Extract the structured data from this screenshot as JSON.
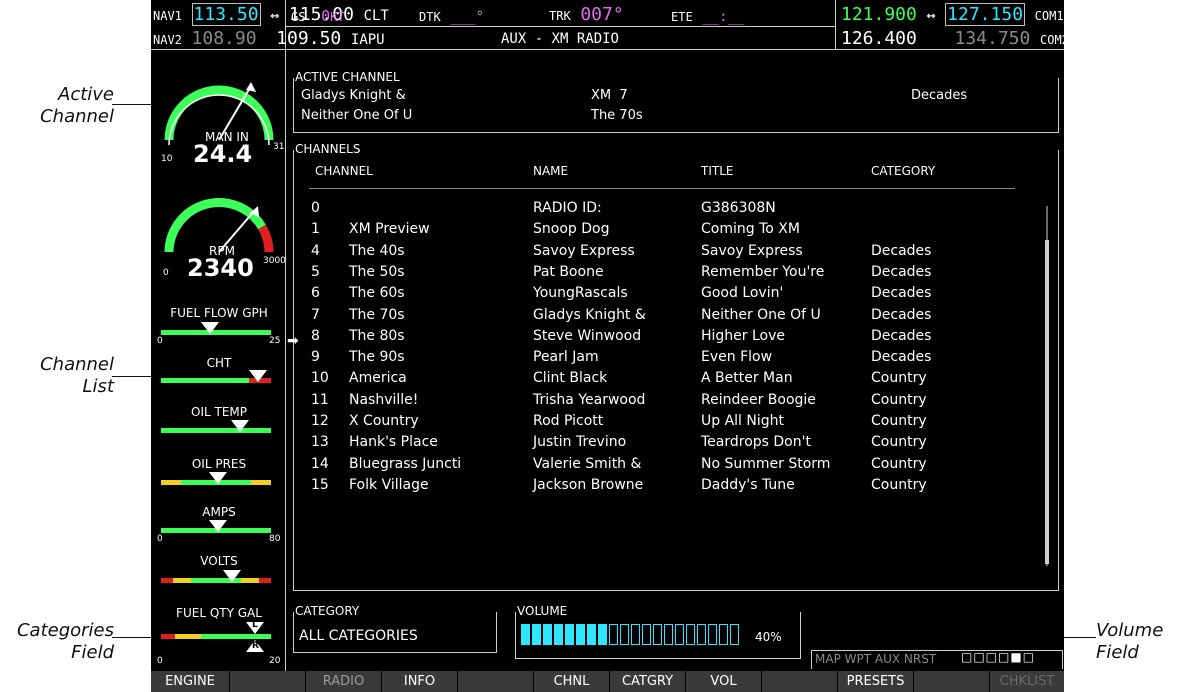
{
  "header": {
    "nav1_label": "NAV1",
    "nav1_active": "113.50",
    "nav1_arrow": "↔",
    "nav1_standby": "115.00",
    "nav1_id": "CLT",
    "nav2_label": "NAV2",
    "nav2_active": "108.90",
    "nav2_standby": "109.50",
    "nav2_id": "IAPU",
    "gs_label": "GS",
    "gs_value": "0",
    "gs_unit": "KT",
    "dtk_label": "DTK",
    "dtk_value": "___°",
    "trk_label": "TRK",
    "trk_value": "007°",
    "ete_label": "ETE",
    "ete_value": "__:__",
    "page_title": "AUX - XM RADIO",
    "com1_active": "121.900",
    "com_arrow": "↔",
    "com1_standby": "127.150",
    "com1_label": "COM1",
    "com2_active": "126.400",
    "com2_standby": "134.750",
    "com2_label": "COM2"
  },
  "engine": {
    "man_in_label": "MAN IN",
    "man_in_value": "24.4",
    "man_in_min": "10",
    "man_in_max": "31",
    "rpm_label": "RPM",
    "rpm_value": "2340",
    "rpm_min": "0",
    "rpm_max": "3000",
    "fuel_flow_label": "FUEL FLOW GPH",
    "fuel_flow_min": "0",
    "fuel_flow_max": "25",
    "cht_label": "CHT",
    "oil_temp_label": "OIL TEMP",
    "oil_pres_label": "OIL PRES",
    "amps_label": "AMPS",
    "amps_min": "0",
    "amps_max": "80",
    "volts_label": "VOLTS",
    "fuel_qty_label": "FUEL QTY GAL",
    "fuel_qty_min": "0",
    "fuel_qty_max": "20",
    "fuel_qty_left": "L",
    "fuel_qty_right": "R"
  },
  "active_channel": {
    "title": "ACTIVE CHANNEL",
    "artist": "Gladys Knight &",
    "song": "Neither One Of U",
    "channel": "XM  7",
    "channel_name": "The 70s",
    "category": "Decades"
  },
  "channels": {
    "title": "CHANNELS",
    "col_channel": "CHANNEL",
    "col_name": "NAME",
    "col_title": "TITLE",
    "col_category": "CATEGORY",
    "rows": [
      {
        "num": "0",
        "channel": "",
        "name": "RADIO ID:",
        "title": "G386308N",
        "category": ""
      },
      {
        "num": "1",
        "channel": "XM Preview",
        "name": "Snoop Dog",
        "title": "Coming To XM",
        "category": ""
      },
      {
        "num": "4",
        "channel": "The 40s",
        "name": "Savoy Express",
        "title": "Savoy Express",
        "category": "Decades"
      },
      {
        "num": "5",
        "channel": "The 50s",
        "name": "Pat Boone",
        "title": "Remember You're",
        "category": "Decades"
      },
      {
        "num": "6",
        "channel": "The 60s",
        "name": "YoungRascals",
        "title": "Good Lovin'",
        "category": "Decades"
      },
      {
        "num": "7",
        "channel": "The 70s",
        "name": "Gladys Knight &",
        "title": "Neither One Of U",
        "category": "Decades"
      },
      {
        "num": "8",
        "channel": "The 80s",
        "name": "Steve Winwood",
        "title": "Higher Love",
        "category": "Decades"
      },
      {
        "num": "9",
        "channel": "The 90s",
        "name": "Pearl Jam",
        "title": "Even Flow",
        "category": "Decades"
      },
      {
        "num": "10",
        "channel": "America",
        "name": "Clint Black",
        "title": "A Better Man",
        "category": "Country"
      },
      {
        "num": "11",
        "channel": "Nashville!",
        "name": "Trisha Yearwood",
        "title": "Reindeer Boogie",
        "category": "Country"
      },
      {
        "num": "12",
        "channel": "X Country",
        "name": "Rod Picott",
        "title": "Up All Night",
        "category": "Country"
      },
      {
        "num": "13",
        "channel": "Hank's Place",
        "name": "Justin Trevino",
        "title": "Teardrops Don't",
        "category": "Country"
      },
      {
        "num": "14",
        "channel": "Bluegrass Juncti",
        "name": "Valerie Smith &",
        "title": "No Summer Storm",
        "category": "Country"
      },
      {
        "num": "15",
        "channel": "Folk Village",
        "name": "Jackson Browne",
        "title": "Daddy's Tune",
        "category": "Country"
      }
    ],
    "current_marker": "➡"
  },
  "category_box": {
    "title": "CATEGORY",
    "value": "ALL CATEGORIES"
  },
  "volume_box": {
    "title": "VOLUME",
    "value_text": "40%",
    "level_fraction": 0.4
  },
  "page_nav": {
    "label": "MAP WPT AUX NRST",
    "squares": "□□□□■□"
  },
  "softkeys": {
    "k1": "ENGINE",
    "k2": "",
    "k3": "RADIO",
    "k4": "INFO",
    "k5": "",
    "k6": "CHNL",
    "k7": "CATGRY",
    "k8": "VOL",
    "k9": "",
    "k10": "PRESETS",
    "k11": "",
    "k12": "CHKLIST"
  },
  "callouts": {
    "active_channel": "Active\nChannel",
    "channel_list": "Channel\nList",
    "categories_field": "Categories\nField",
    "volume_field": "Volume\nField"
  },
  "colors": {
    "cyan": "#2ee6ff",
    "green": "#3dff5a",
    "magenta": "#e06cf0",
    "white": "#ffffff",
    "background": "#000000"
  }
}
